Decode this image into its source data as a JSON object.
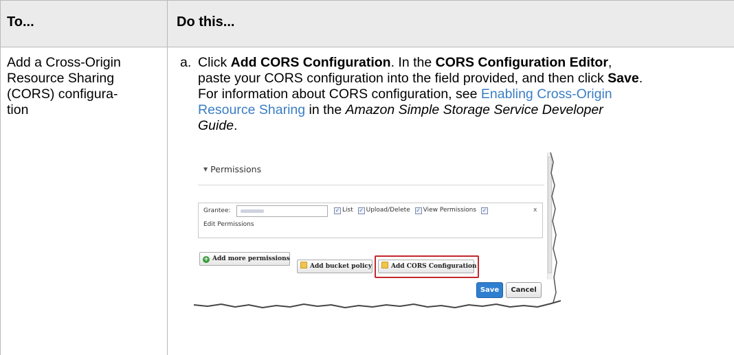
{
  "table": {
    "header": {
      "col1": "To...",
      "col2": "Do this..."
    },
    "row": {
      "task_lines": [
        "Add a Cross-Origin",
        "Resource Sharing",
        "(CORS) configura-",
        "tion"
      ],
      "step": {
        "letter": "a.",
        "t1": "Click ",
        "b1": "Add CORS Configuration",
        "t2": ". In the ",
        "b2": "CORS Configuration Editor",
        "t3": ",",
        "t4": "paste your CORS configuration into the field provided, and then click ",
        "b3": "Save",
        "t5": ".",
        "t6": "For information about CORS configuration, see ",
        "link1": "Enabling Cross-Origin",
        "link2": "Resource Sharing",
        "t7": " in the ",
        "i1": "Amazon Simple Storage Service Developer",
        "i2": "Guide",
        "t8": "."
      }
    }
  },
  "screenshot": {
    "section_title": "Permissions",
    "grantee_label": "Grantee:",
    "checkboxes": [
      "List",
      "Upload/Delete",
      "View Permissions"
    ],
    "close": "x",
    "edit_permissions": "Edit Permissions",
    "add_more": "Add more permissions",
    "add_bucket_policy": "Add bucket policy",
    "add_cors": "Add CORS Configuration",
    "save": "Save",
    "cancel": "Cancel",
    "highlight_color": "#c3272c",
    "save_color": "#2f7fd0"
  },
  "colors": {
    "link": "#3a7dc3",
    "header_bg": "#ebebeb",
    "rule": "#b9b9b9"
  }
}
